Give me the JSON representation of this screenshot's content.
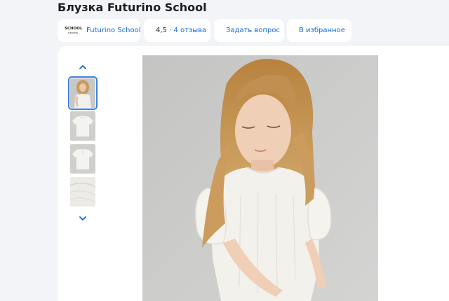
{
  "product": {
    "title": "Блузка Futurino School"
  },
  "brand": {
    "logo_text": "SCHOOL",
    "logo_sub": "futurino",
    "name": "Futurino School"
  },
  "rating": {
    "value": "4,5",
    "separator": "·",
    "reviews": "4 отзыва"
  },
  "actions": {
    "ask_label": "Задать вопрос",
    "favorite_label": "В избранное"
  },
  "gallery": {
    "thumbnails": [
      "photo-girl",
      "blouse-front",
      "blouse-back",
      "fabric-detail"
    ],
    "active_index": 0
  },
  "colors": {
    "accent": "#1168d6",
    "star": "#f6b400",
    "page_bg": "#f2f4f7"
  }
}
